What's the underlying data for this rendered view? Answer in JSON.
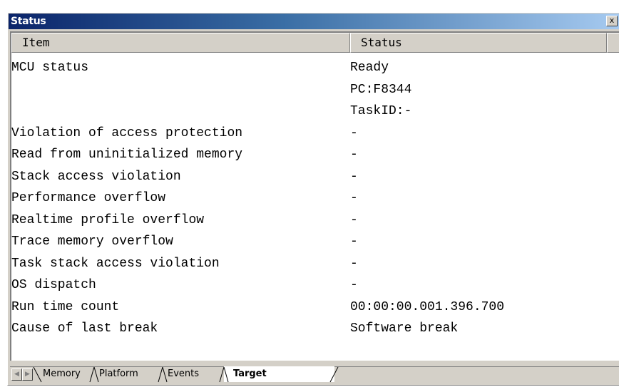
{
  "window": {
    "title": "Status",
    "close_label": "x"
  },
  "table": {
    "columns": [
      "Item",
      "Status"
    ],
    "rows": [
      {
        "item": "MCU status",
        "status": "Ready"
      },
      {
        "item": "",
        "status": "PC:F8344"
      },
      {
        "item": "",
        "status": "TaskID:-"
      },
      {
        "item": "Violation of access protection",
        "status": "-"
      },
      {
        "item": "Read from uninitialized memory",
        "status": "-"
      },
      {
        "item": "Stack access violation",
        "status": "-"
      },
      {
        "item": "Performance overflow",
        "status": "-"
      },
      {
        "item": "Realtime profile overflow",
        "status": "-"
      },
      {
        "item": "Trace memory overflow",
        "status": "-"
      },
      {
        "item": "Task stack access violation",
        "status": "-"
      },
      {
        "item": "OS dispatch",
        "status": "-"
      },
      {
        "item": "Run time count",
        "status": "00:00:00.001.396.700"
      },
      {
        "item": "Cause of last break",
        "status": "Software break"
      }
    ]
  },
  "tabs": {
    "items": [
      "Memory",
      "Platform",
      "Events",
      "Target"
    ],
    "active": "Target"
  },
  "icons": {
    "scroll_left": "triangle-left-icon",
    "scroll_right": "triangle-right-icon"
  },
  "colors": {
    "title_gradient_start": "#0a246a",
    "title_gradient_end": "#a6caf0",
    "chrome": "#d4d0c8"
  }
}
